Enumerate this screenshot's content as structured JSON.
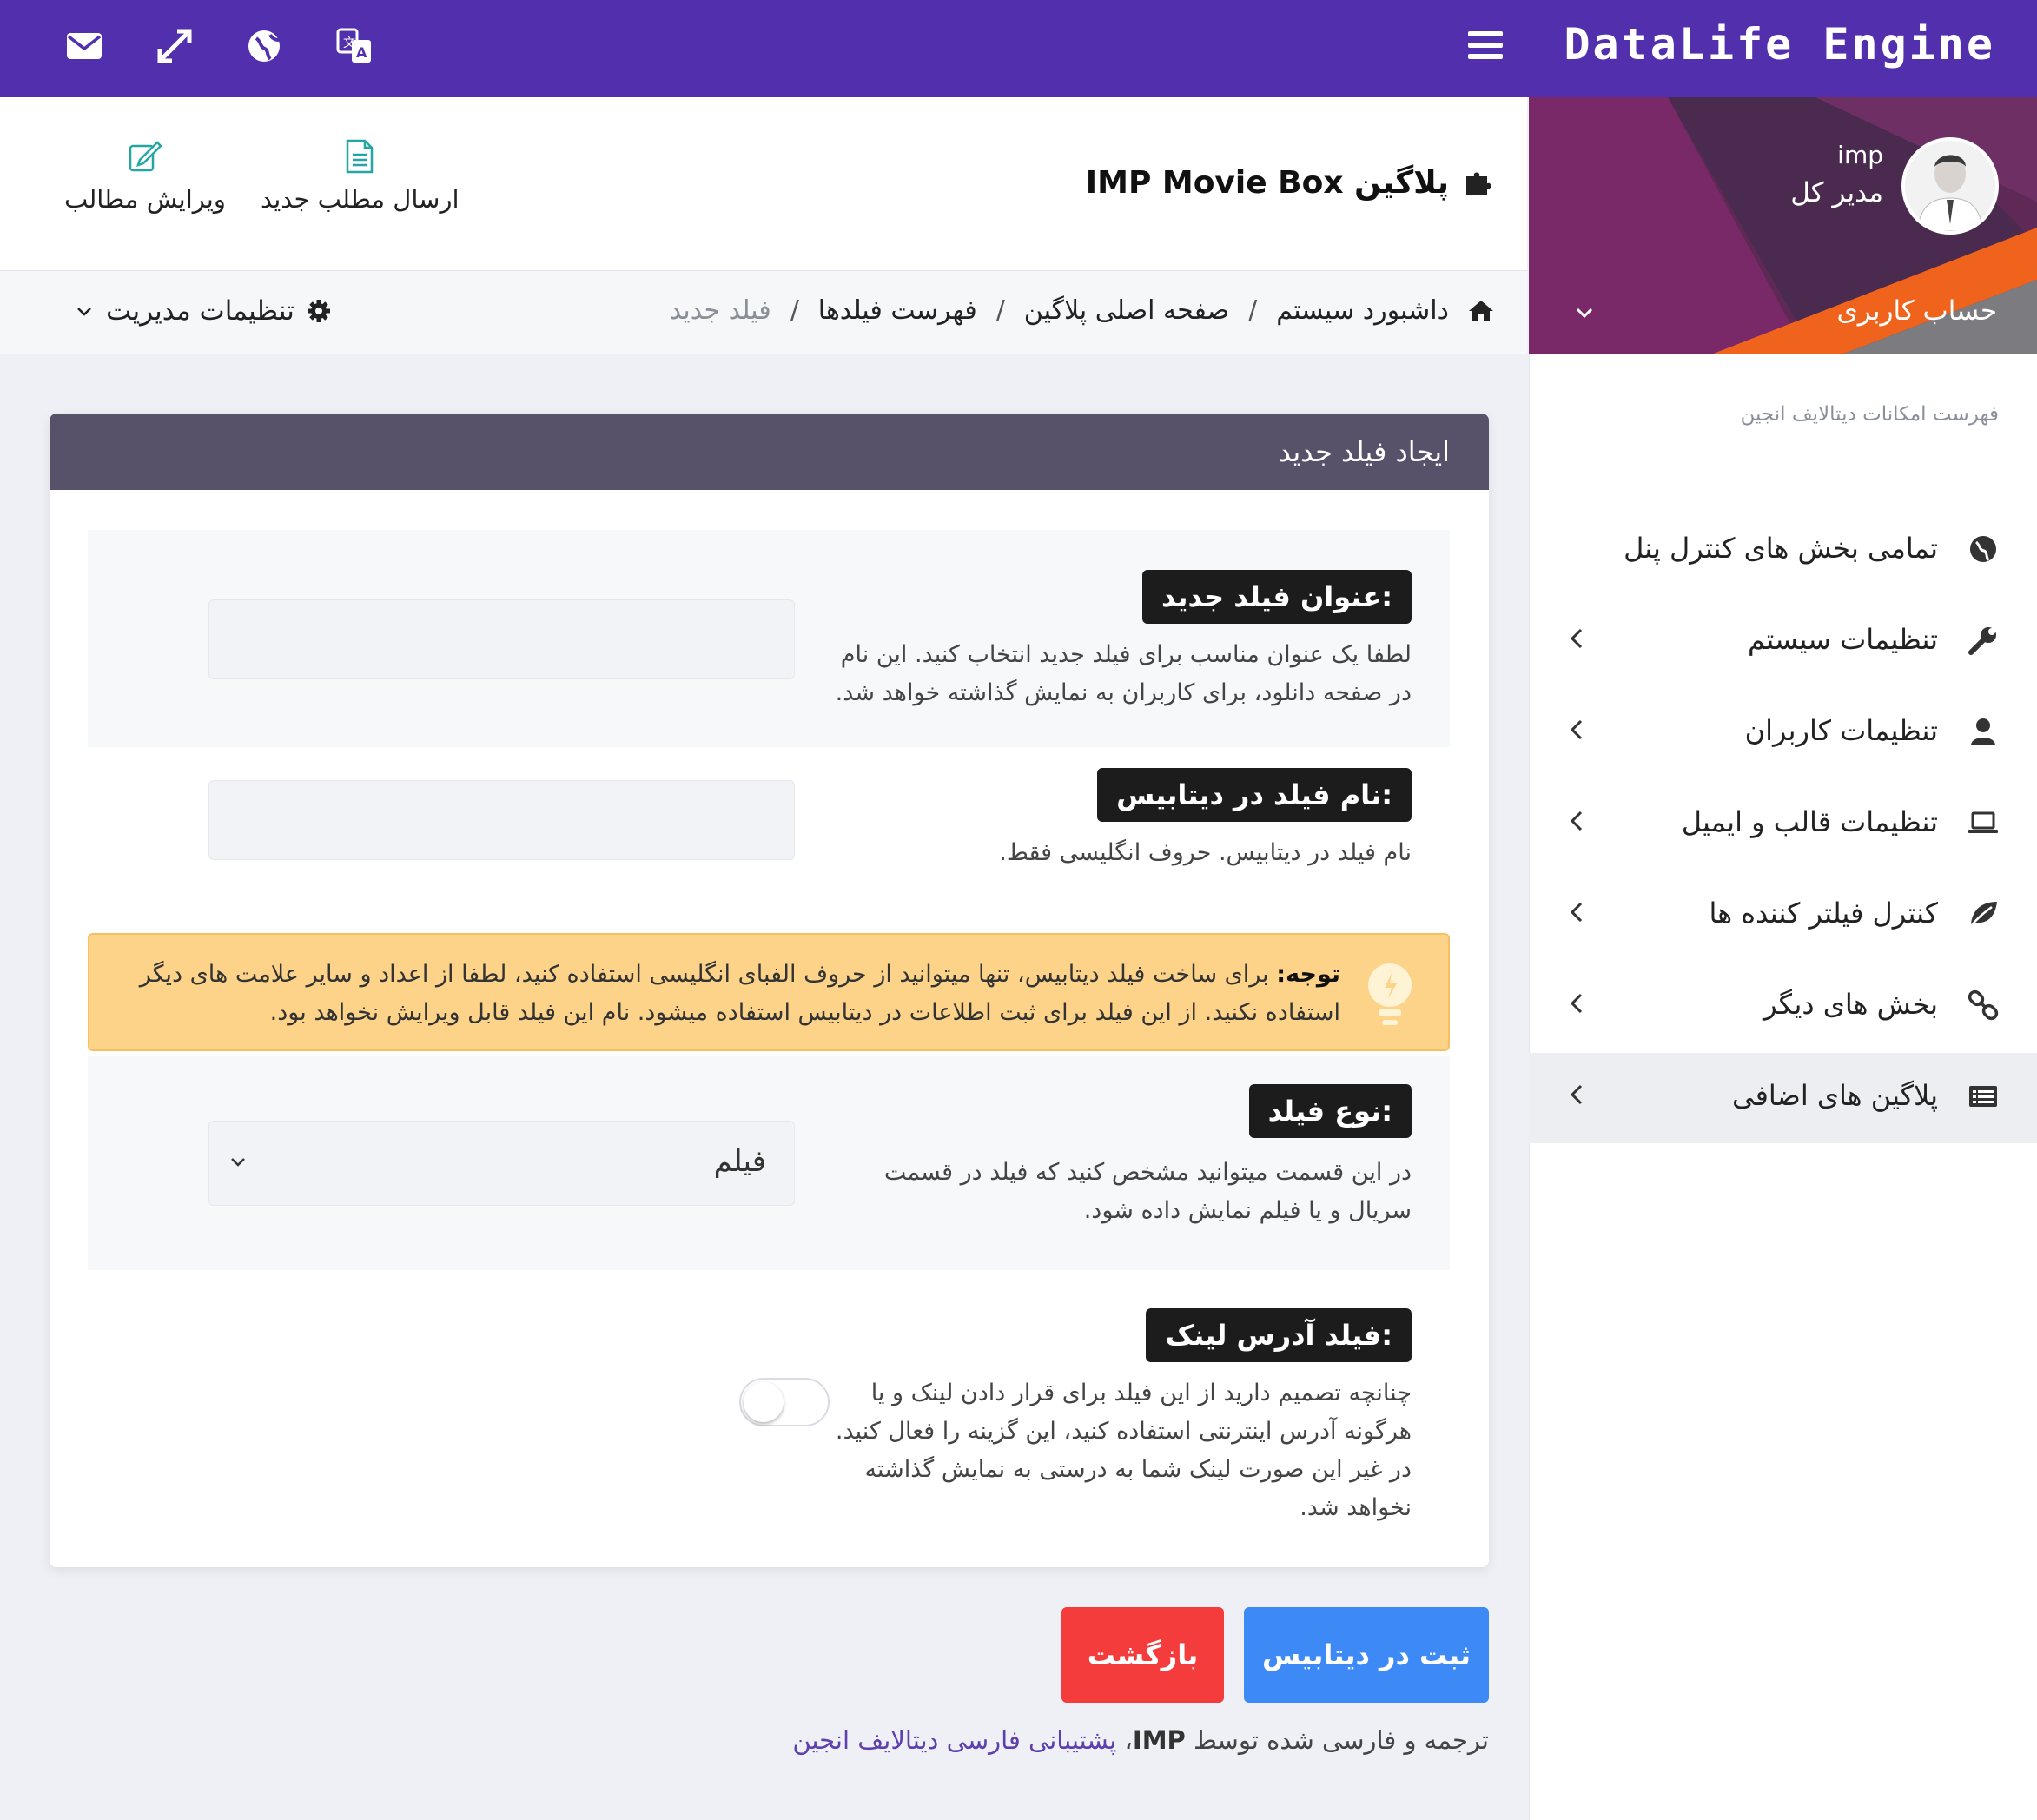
{
  "topbar": {
    "brand": "DataLife Engine",
    "icons": [
      "mail-icon",
      "fullscreen-icon",
      "globe-icon",
      "translate-icon",
      "menu-icon"
    ]
  },
  "profile": {
    "username": "imp",
    "role": "مدیر کل",
    "account_label": "حساب کاربری"
  },
  "sidebar": {
    "caption": "فهرست امکانات دیتالایف انجین",
    "items": [
      {
        "label": "تمامی بخش های کنترل پنل",
        "icon": "globe-icon"
      },
      {
        "label": "تنظیمات سیستم",
        "icon": "wrench-icon"
      },
      {
        "label": "تنظیمات کاربران",
        "icon": "user-icon"
      },
      {
        "label": "تنظیمات قالب و ایمیل",
        "icon": "laptop-icon"
      },
      {
        "label": "کنترل فیلتر کننده ها",
        "icon": "leaf-icon"
      },
      {
        "label": "بخش های دیگر",
        "icon": "link-icon"
      },
      {
        "label": "پلاگین های اضافی",
        "icon": "list-icon"
      }
    ]
  },
  "header": {
    "title": "پلاگین IMP Movie Box",
    "new_post": "ارسال مطلب جدید",
    "edit_posts": "ویرایش مطالب"
  },
  "breadcrumb": {
    "items": [
      "داشبورد سیستم",
      "صفحه اصلی پلاگین",
      "فهرست فیلدها"
    ],
    "separator": "/",
    "current": "فیلد جدید",
    "admin_settings": "تنظیمات مدیریت"
  },
  "panel": {
    "title": "ایجاد فیلد جدید",
    "field_title": {
      "label": "عنوان فیلد جدید:",
      "desc": "لطفا یک عنوان مناسب برای فیلد جدید انتخاب کنید. این نام در صفحه دانلود، برای کاربران به نمایش گذاشته خواهد شد.",
      "value": ""
    },
    "field_db_name": {
      "label": "نام فیلد در دیتابیس:",
      "desc": "نام فیلد در دیتابیس. حروف انگلیسی فقط.",
      "value": ""
    },
    "notice": {
      "bold": "توجه:",
      "text": " برای ساخت فیلد دیتابیس، تنها میتوانید از حروف الفبای انگلیسی استفاده کنید، لطفا از اعداد و سایر علامت های دیگر استفاده نکنید. از این فیلد برای ثبت اطلاعات در دیتابیس استفاده میشود. نام این فیلد قابل ویرایش نخواهد بود."
    },
    "field_type": {
      "label": "نوع فیلد:",
      "desc": "در این قسمت میتوانید مشخص کنید که فیلد در قسمت سریال و یا فیلم نمایش داده شود.",
      "value": "فیلم"
    },
    "field_link": {
      "label": "فیلد آدرس لینک:",
      "desc": "چنانچه تصمیم دارید از این فیلد برای قرار دادن لینک و یا هرگونه آدرس اینترنتی استفاده کنید، این گزینه را فعال کنید. در غیر این صورت لینک شما به درستی به نمایش گذاشته نخواهد شد.",
      "enabled": false
    }
  },
  "buttons": {
    "save": "ثبت در دیتابیس",
    "back": "بازگشت"
  },
  "footer": {
    "prefix": "ترجمه و فارسی شده توسط ",
    "imp": "IMP",
    "comma": "، ",
    "link": "پشتیبانی فارسی دیتالایف انجین"
  },
  "colors": {
    "topbar": "#5230ad",
    "panel_header": "#57526a",
    "save": "#3d8af7",
    "back": "#f43c3c",
    "notice": "#fcd389"
  }
}
